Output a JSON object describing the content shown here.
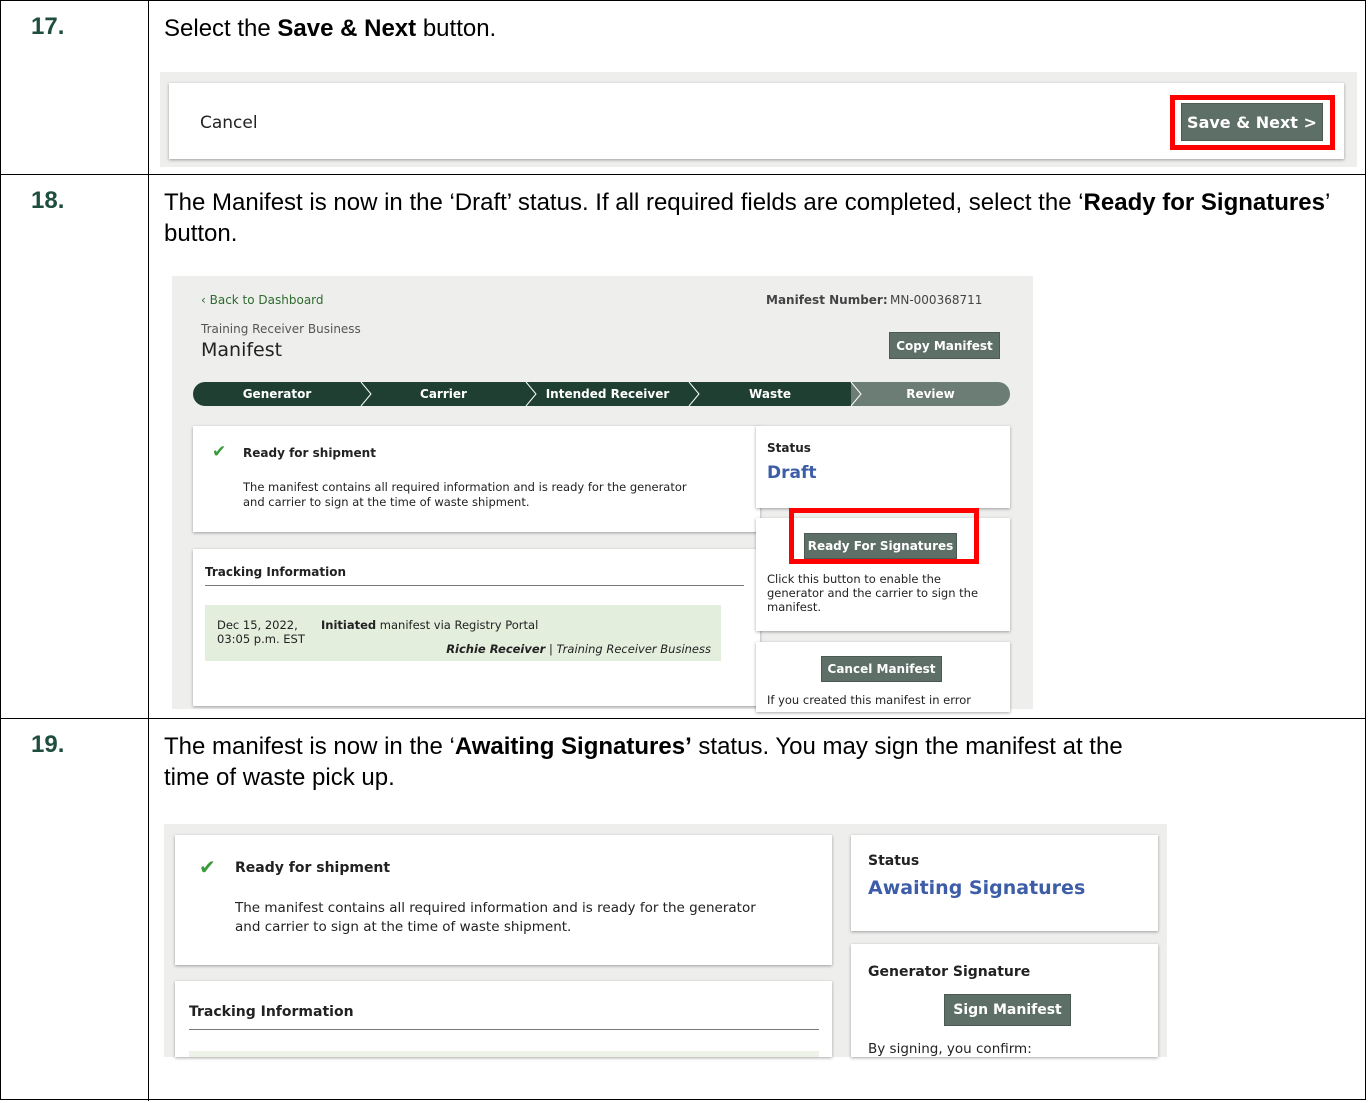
{
  "step17": {
    "number": "17.",
    "text_before": "Select the ",
    "text_bold": "Save & Next",
    "text_after": " button.",
    "footer": {
      "cancel_label": "Cancel",
      "save_label": "Save & Next >"
    }
  },
  "step18": {
    "number": "18.",
    "text_before": "The Manifest is now in the ‘Draft’ status. If all required fields are completed, select the ‘",
    "text_bold": "Ready for Signatures",
    "text_after": "’ button.",
    "shot": {
      "back_link": "‹ Back to Dashboard",
      "manifest_number_label": "Manifest Number:",
      "manifest_number": "MN-000368711",
      "business_name": "Training Receiver Business",
      "page_title": "Manifest",
      "copy_button": "Copy Manifest",
      "steps": [
        "Generator",
        "Carrier",
        "Intended Receiver",
        "Waste",
        "Review"
      ],
      "ready_title": "Ready for shipment",
      "ready_text_line1": "The manifest contains all required information and is ready for the generator",
      "ready_text_line2": "and carrier to sign at the time of waste shipment.",
      "status_label": "Status",
      "status_value": "Draft",
      "ready_sign_button": "Ready For Signatures",
      "ready_sign_help_line1": "Click this button to enable the",
      "ready_sign_help_line2": "generator and the carrier to sign the",
      "ready_sign_help_line3": "manifest.",
      "tracking_title": "Tracking Information",
      "tracking_date_line1": "Dec 15, 2022,",
      "tracking_date_line2": "03:05 p.m. EST",
      "tracking_action_bold": "Initiated",
      "tracking_action_rest": " manifest via Registry Portal",
      "tracking_user": "Richie Receiver",
      "tracking_sep": " | ",
      "tracking_org": "Training Receiver Business",
      "cancel_manifest_button": "Cancel Manifest",
      "cancel_help": "If you created this manifest in error"
    }
  },
  "step19": {
    "number": "19.",
    "text_before": "The manifest is now in the ‘",
    "text_bold": "Awaiting Signatures’",
    "text_after": " status. You may sign the manifest at the",
    "text_line2": "time of waste pick up.",
    "shot": {
      "ready_title": "Ready for shipment",
      "ready_text_line1": "The manifest contains all required information and is ready for the generator",
      "ready_text_line2": "and carrier to sign at the time of waste shipment.",
      "status_label": "Status",
      "status_value": "Awaiting Signatures",
      "tracking_title": "Tracking Information",
      "generator_sig_title": "Generator Signature",
      "sign_button": "Sign Manifest",
      "sign_help": "By signing, you confirm:"
    }
  },
  "colors": {
    "accent_green": "#1f4e3d",
    "button_gray_green": "#5e6f68",
    "highlight_red": "#ff0000",
    "status_blue": "#3d5da8",
    "check_green": "#3a9b3a"
  }
}
